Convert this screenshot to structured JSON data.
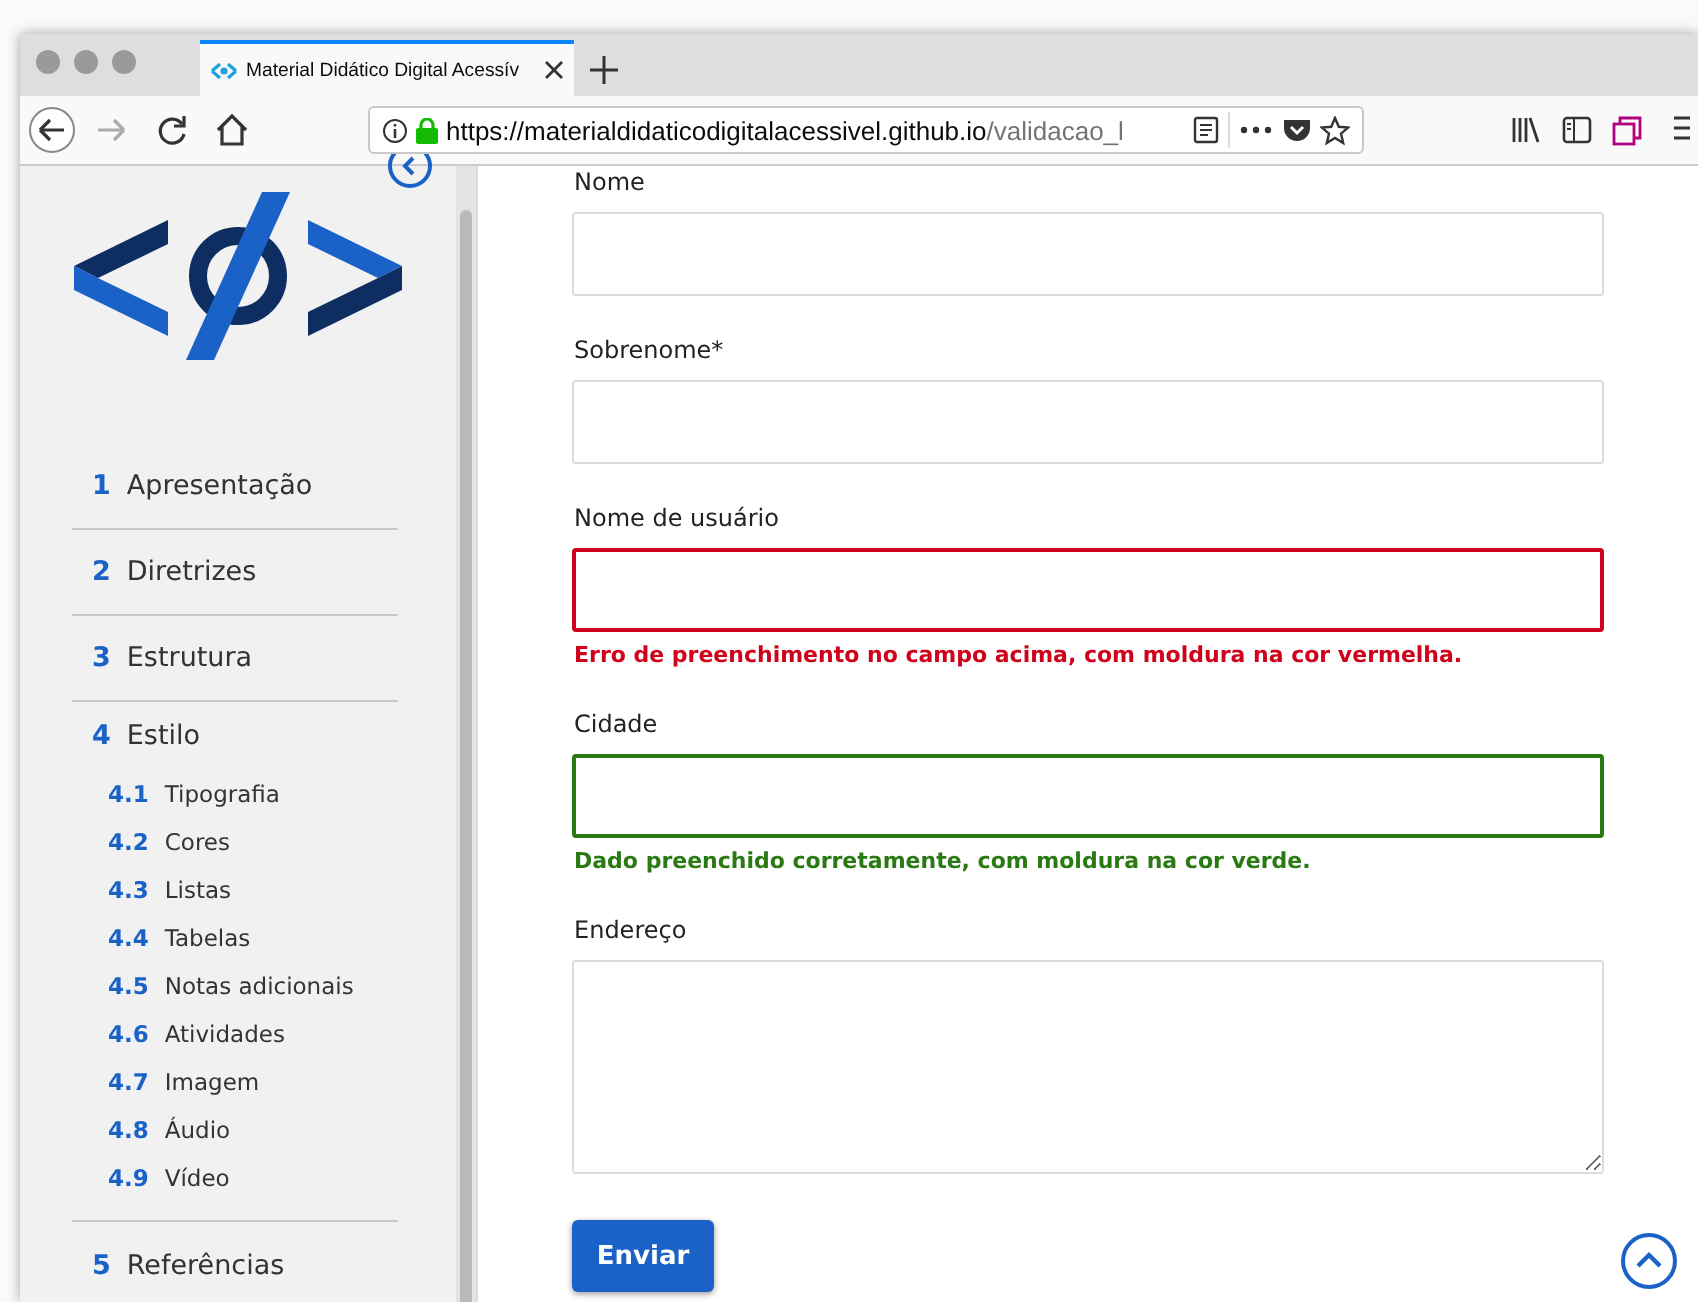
{
  "browser": {
    "tab_title": "Material Didático Digital Acessív",
    "url_host": "https://materialdidaticodigitalacessivel.github.io",
    "url_path": "/validacao_l"
  },
  "sidebar": {
    "items": [
      {
        "number": "1",
        "label": "Apresentação"
      },
      {
        "number": "2",
        "label": "Diretrizes"
      },
      {
        "number": "3",
        "label": "Estrutura"
      },
      {
        "number": "4",
        "label": "Estilo",
        "children": [
          {
            "number": "4.1",
            "label": "Tipografia"
          },
          {
            "number": "4.2",
            "label": "Cores"
          },
          {
            "number": "4.3",
            "label": "Listas"
          },
          {
            "number": "4.4",
            "label": "Tabelas"
          },
          {
            "number": "4.5",
            "label": "Notas adicionais"
          },
          {
            "number": "4.6",
            "label": "Atividades"
          },
          {
            "number": "4.7",
            "label": "Imagem"
          },
          {
            "number": "4.8",
            "label": "Áudio"
          },
          {
            "number": "4.9",
            "label": "Vídeo"
          }
        ]
      },
      {
        "number": "5",
        "label": "Referências"
      }
    ]
  },
  "form": {
    "fields": [
      {
        "kind": "input",
        "label": "Nome",
        "error": false,
        "valid": false
      },
      {
        "kind": "input",
        "label": "Sobrenome*",
        "error": false,
        "valid": false
      },
      {
        "kind": "input",
        "label": "Nome de usuário",
        "error": true,
        "valid": false,
        "message": "Erro de preenchimento no campo acima, com moldura na cor vermelha."
      },
      {
        "kind": "input",
        "label": "Cidade",
        "error": false,
        "valid": true,
        "message": "Dado preenchido corretamente, com moldura na cor verde."
      },
      {
        "kind": "textarea",
        "label": "Endereço",
        "error": false,
        "valid": false
      }
    ],
    "submit": "Enviar"
  }
}
